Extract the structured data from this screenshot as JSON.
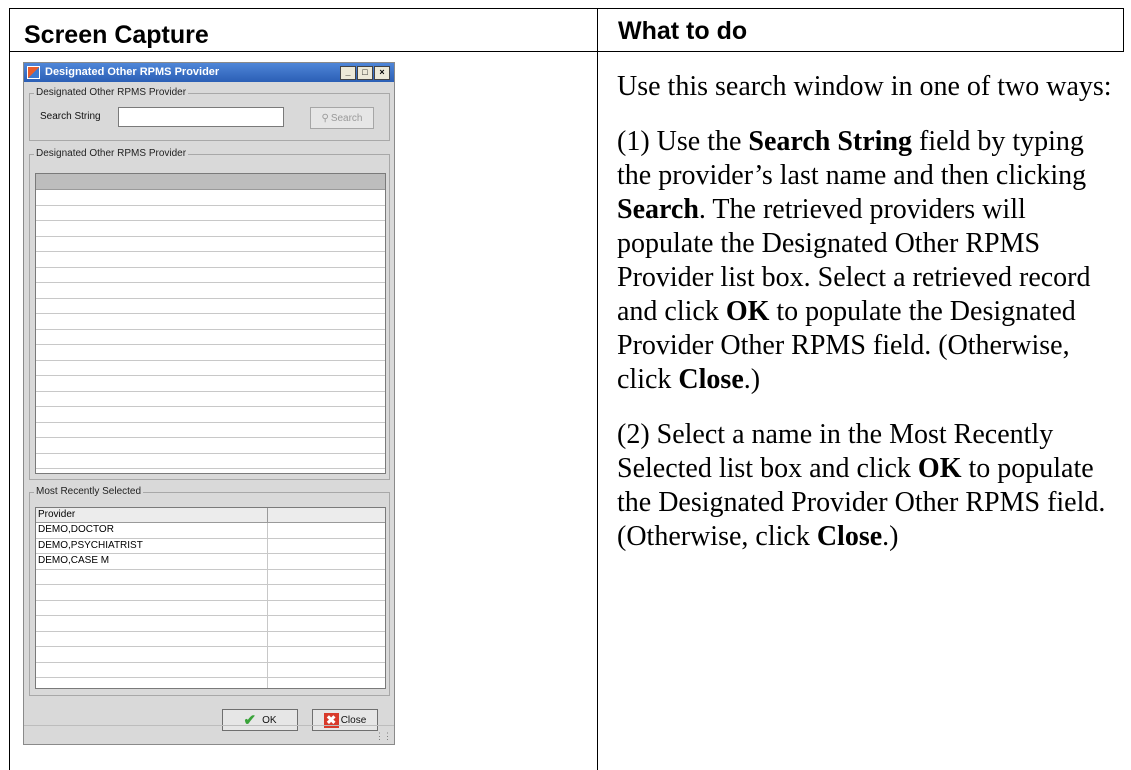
{
  "table": {
    "col1_header": "Screen Capture",
    "col2_header": "What to do"
  },
  "dialog": {
    "title": "Designated Other RPMS Provider",
    "window_buttons": [
      "_",
      "□",
      "×"
    ],
    "search_group_label": "Designated Other RPMS Provider",
    "search_label": "Search String",
    "search_value": "",
    "search_button": "Search",
    "results_group_label": "Designated Other RPMS Provider",
    "recent_group_label": "Most Recently Selected",
    "recent_column_header": "Provider",
    "recent_rows": [
      "DEMO,DOCTOR",
      "DEMO,PSYCHIATRIST",
      "DEMO,CASE M"
    ],
    "ok_button": "OK",
    "close_button": "Close"
  },
  "instructions": {
    "p1": "Use this search window in one of two ways:",
    "p2": {
      "a": "(1) Use the ",
      "b": "Search String",
      "c": " field by typing the provider’s last name and then clicking ",
      "d": "Search",
      "e": ". The retrieved providers will populate the Designated Other RPMS Provider list box. Select a retrieved record and click ",
      "f": "OK",
      "g": " to populate the Designated Provider Other RPMS field. (Otherwise, click ",
      "h": "Close",
      "i": ".)"
    },
    "p3": {
      "a": "(2) Select a name in the Most Recently Selected list box and click ",
      "b": "OK",
      "c": " to populate the Designated Provider Other RPMS field. (Otherwise, click ",
      "d": "Close",
      "e": ".)"
    }
  },
  "colors": {
    "title_bar": "#2b5fb5",
    "dialog_bg": "#d9d9d9",
    "ok_check": "#3aa33a",
    "close_x": "#d83a2a"
  }
}
